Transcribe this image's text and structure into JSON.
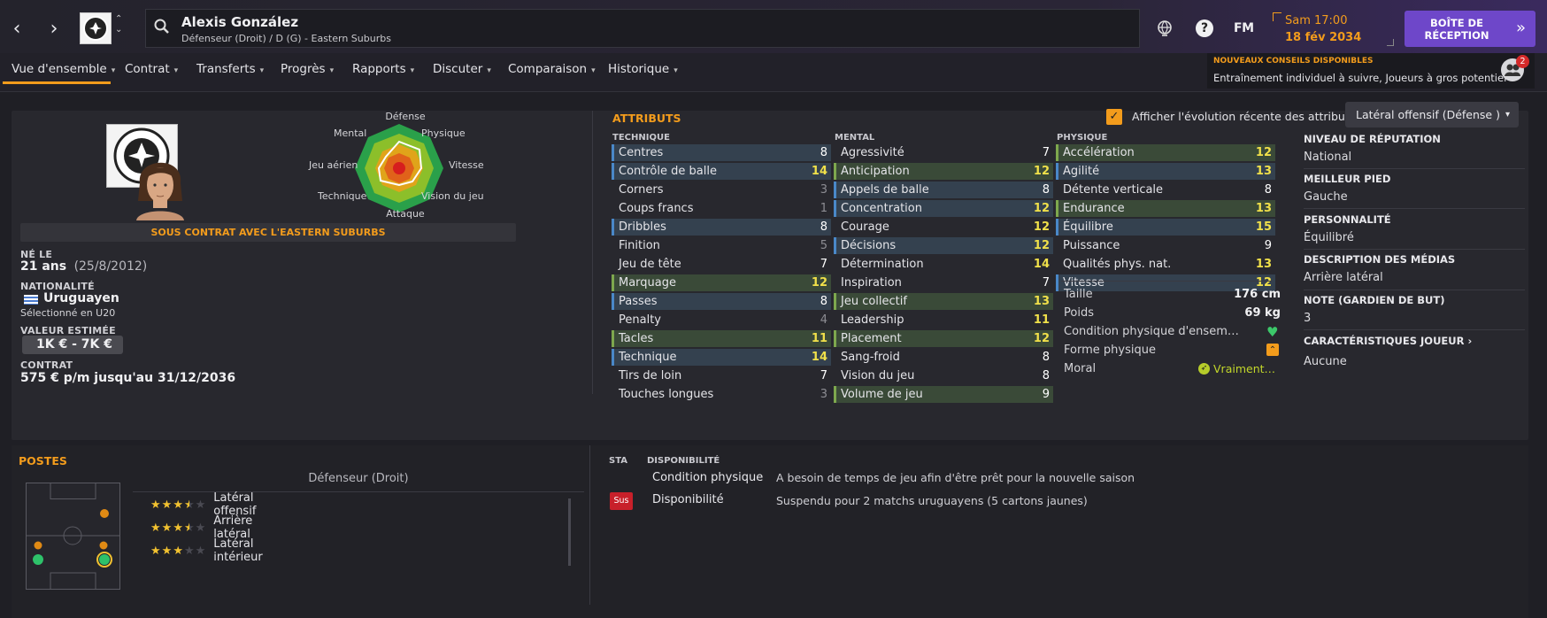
{
  "header": {
    "player_name": "Alexis González",
    "player_desc": "Défenseur (Droit) / D (G) - Eastern Suburbs",
    "date_time": "Sam 17:00",
    "date": "18 fév 2034",
    "inbox_label_1": "BOÎTE DE",
    "inbox_label_2": "RÉCEPTION",
    "fm_label": "FM"
  },
  "tabs": [
    {
      "label": "Vue d'ensemble"
    },
    {
      "label": "Contrat"
    },
    {
      "label": "Transferts"
    },
    {
      "label": "Progrès"
    },
    {
      "label": "Rapports"
    },
    {
      "label": "Discuter"
    },
    {
      "label": "Comparaison"
    },
    {
      "label": "Historique"
    }
  ],
  "notification": {
    "title": "NOUVEAUX CONSEILS DISPONIBLES",
    "text": "Entraînement individuel à suivre, Joueurs à gros potentiel",
    "count": "2"
  },
  "radar": {
    "labels": {
      "top": "Défense",
      "top_right": "Physique",
      "right": "Vitesse",
      "bottom_right": "Vision du jeu",
      "bottom": "Attaque",
      "bottom_left": "Technique",
      "left": "Jeu aérien",
      "top_left": "Mental"
    }
  },
  "profile": {
    "contract_banner": "SOUS CONTRAT AVEC L'EASTERN SUBURBS",
    "born_label": "NÉ LE",
    "age": "21 ans",
    "birthdate": "(25/8/2012)",
    "nationality_label": "NATIONALITÉ",
    "nationality": "Uruguayen",
    "selection": "Sélectionné en U20",
    "value_label": "VALEUR ESTIMÉE",
    "value": "1K € - 7K €",
    "contract_label": "CONTRAT",
    "contract": "575 € p/m jusqu'au 31/12/2036"
  },
  "attributes": {
    "title": "ATTRIBUTS",
    "show_evolution_label": "Afficher l'évolution récente des attributs",
    "role_select": "Latéral offensif (Défense )",
    "technique_header": "TECHNIQUE",
    "mental_header": "MENTAL",
    "physique_header": "PHYSIQUE",
    "technique": [
      {
        "name": "Centres",
        "value": "8",
        "hl": "hb",
        "vc": ""
      },
      {
        "name": "Contrôle de balle",
        "value": "14",
        "hl": "hb",
        "vc": "y"
      },
      {
        "name": "Corners",
        "value": "3",
        "hl": "",
        "vc": "dim"
      },
      {
        "name": "Coups francs",
        "value": "1",
        "hl": "",
        "vc": "dim"
      },
      {
        "name": "Dribbles",
        "value": "8",
        "hl": "hb",
        "vc": ""
      },
      {
        "name": "Finition",
        "value": "5",
        "hl": "",
        "vc": "dim"
      },
      {
        "name": "Jeu de tête",
        "value": "7",
        "hl": "",
        "vc": ""
      },
      {
        "name": "Marquage",
        "value": "12",
        "hl": "hg",
        "vc": "y"
      },
      {
        "name": "Passes",
        "value": "8",
        "hl": "hb",
        "vc": ""
      },
      {
        "name": "Penalty",
        "value": "4",
        "hl": "",
        "vc": "dim"
      },
      {
        "name": "Tacles",
        "value": "11",
        "hl": "hg",
        "vc": "y"
      },
      {
        "name": "Technique",
        "value": "14",
        "hl": "hb",
        "vc": "y"
      },
      {
        "name": "Tirs de loin",
        "value": "7",
        "hl": "",
        "vc": ""
      },
      {
        "name": "Touches longues",
        "value": "3",
        "hl": "",
        "vc": "dim"
      }
    ],
    "mental": [
      {
        "name": "Agressivité",
        "value": "7",
        "hl": "",
        "vc": ""
      },
      {
        "name": "Anticipation",
        "value": "12",
        "hl": "hg",
        "vc": "y"
      },
      {
        "name": "Appels de balle",
        "value": "8",
        "hl": "hb",
        "vc": ""
      },
      {
        "name": "Concentration",
        "value": "12",
        "hl": "hb",
        "vc": "y"
      },
      {
        "name": "Courage",
        "value": "12",
        "hl": "",
        "vc": "y"
      },
      {
        "name": "Décisions",
        "value": "12",
        "hl": "hb",
        "vc": "y"
      },
      {
        "name": "Détermination",
        "value": "14",
        "hl": "",
        "vc": "y"
      },
      {
        "name": "Inspiration",
        "value": "7",
        "hl": "",
        "vc": ""
      },
      {
        "name": "Jeu collectif",
        "value": "13",
        "hl": "hg",
        "vc": "y"
      },
      {
        "name": "Leadership",
        "value": "11",
        "hl": "",
        "vc": "y"
      },
      {
        "name": "Placement",
        "value": "12",
        "hl": "hg",
        "vc": "y"
      },
      {
        "name": "Sang-froid",
        "value": "8",
        "hl": "",
        "vc": ""
      },
      {
        "name": "Vision du jeu",
        "value": "8",
        "hl": "",
        "vc": ""
      },
      {
        "name": "Volume de jeu",
        "value": "9",
        "hl": "hg",
        "vc": ""
      }
    ],
    "physique": [
      {
        "name": "Accélération",
        "value": "12",
        "hl": "hg",
        "vc": "y"
      },
      {
        "name": "Agilité",
        "value": "13",
        "hl": "hb",
        "vc": "y"
      },
      {
        "name": "Détente verticale",
        "value": "8",
        "hl": "",
        "vc": ""
      },
      {
        "name": "Endurance",
        "value": "13",
        "hl": "hg",
        "vc": "y"
      },
      {
        "name": "Équilibre",
        "value": "15",
        "hl": "hb",
        "vc": "y"
      },
      {
        "name": "Puissance",
        "value": "9",
        "hl": "",
        "vc": ""
      },
      {
        "name": "Qualités phys. nat.",
        "value": "13",
        "hl": "",
        "vc": "y"
      },
      {
        "name": "Vitesse",
        "value": "12",
        "hl": "hb",
        "vc": "y"
      }
    ],
    "height_label": "Taille",
    "height": "176 cm",
    "weight_label": "Poids",
    "weight": "69 kg",
    "condition_label": "Condition physique d'ensem…",
    "form_label": "Forme physique",
    "morale_label": "Moral",
    "morale_value": "Vraiment…"
  },
  "info": {
    "reputation_label": "NIVEAU DE RÉPUTATION",
    "reputation": "National",
    "foot_label": "MEILLEUR PIED",
    "foot": "Gauche",
    "personality_label": "PERSONNALITÉ",
    "personality": "Équilibré",
    "media_label": "DESCRIPTION DES MÉDIAS",
    "media": "Arrière latéral",
    "gk_label": "NOTE (GARDIEN DE BUT)",
    "gk": "3",
    "traits_label": "CARACTÉRISTIQUES JOUEUR",
    "traits": "Aucune"
  },
  "positions": {
    "title": "POSTES",
    "main": "Défenseur (Droit)",
    "list": [
      {
        "label": "Latéral offensif",
        "stars": 3.5
      },
      {
        "label": "Arrière latéral",
        "stars": 3.5
      },
      {
        "label": "Latéral intérieur",
        "stars": 3
      }
    ]
  },
  "availability": {
    "sta_header": "STA",
    "dispo_header": "DISPONIBILITÉ",
    "rows": [
      {
        "badge": "",
        "label": "Condition physique",
        "text": "A besoin de temps de jeu afin d'être prêt pour la nouvelle saison"
      },
      {
        "badge": "Sus",
        "label": "Disponibilité",
        "text": "Suspendu pour 2 matchs uruguayens (5 cartons jaunes)"
      }
    ]
  },
  "colors": {
    "accent": "#f39c1c",
    "inbox": "#6e47c9",
    "highlight_yellow": "#f0e04a"
  }
}
